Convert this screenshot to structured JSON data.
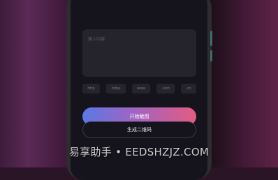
{
  "input": {
    "placeholder": "输入内容"
  },
  "prefixes": [
    "http",
    "https",
    "www",
    ".com",
    ".cn"
  ],
  "primary_button": {
    "label": "开始截图"
  },
  "secondary_button": {
    "label": "生成二维码"
  },
  "watermark": {
    "text": "易享助手 • EEDSHZJZ.COM"
  },
  "colors": {
    "gradient_start": "#5b78e6",
    "gradient_mid": "#a762bd",
    "gradient_end": "#e35c80",
    "screen_bg": "#15141c"
  }
}
